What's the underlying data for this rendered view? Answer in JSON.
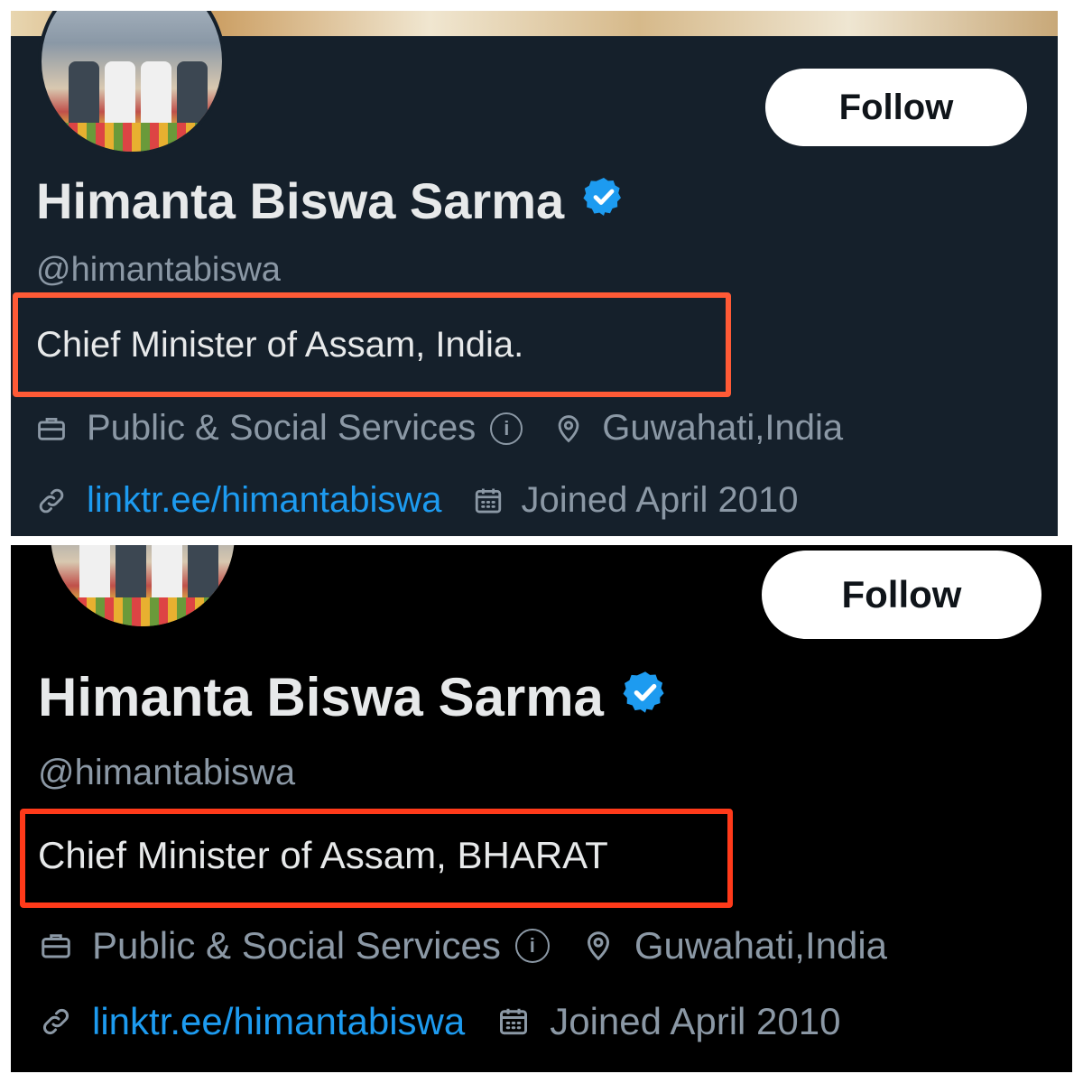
{
  "panels": [
    {
      "name": "Himanta Biswa Sarma",
      "handle": "@himantabiswa",
      "follow_label": "Follow",
      "bio": "Chief Minister of Assam, India.",
      "category": "Public & Social Services",
      "location": "Guwahati,India",
      "link": "linktr.ee/himantabiswa",
      "joined": "Joined April 2010",
      "info_icon": "i",
      "background_color": "#15202b"
    },
    {
      "name": "Himanta Biswa Sarma",
      "handle": "@himantabiswa",
      "follow_label": "Follow",
      "bio": "Chief Minister of Assam, BHARAT",
      "category": "Public & Social Services",
      "location": "Guwahati,India",
      "link": "linktr.ee/himantabiswa",
      "joined": "Joined April 2010",
      "info_icon": "i",
      "background_color": "#000000"
    }
  ],
  "colors": {
    "highlight_box": "#ff5a36",
    "verified_badge": "#1d9bf0",
    "link": "#1d9bf0",
    "primary_text": "#e7e9ea",
    "secondary_text": "#8b98a5"
  },
  "icons": [
    "verified-badge-icon",
    "briefcase-icon",
    "info-icon",
    "location-pin-icon",
    "link-icon",
    "calendar-icon"
  ]
}
